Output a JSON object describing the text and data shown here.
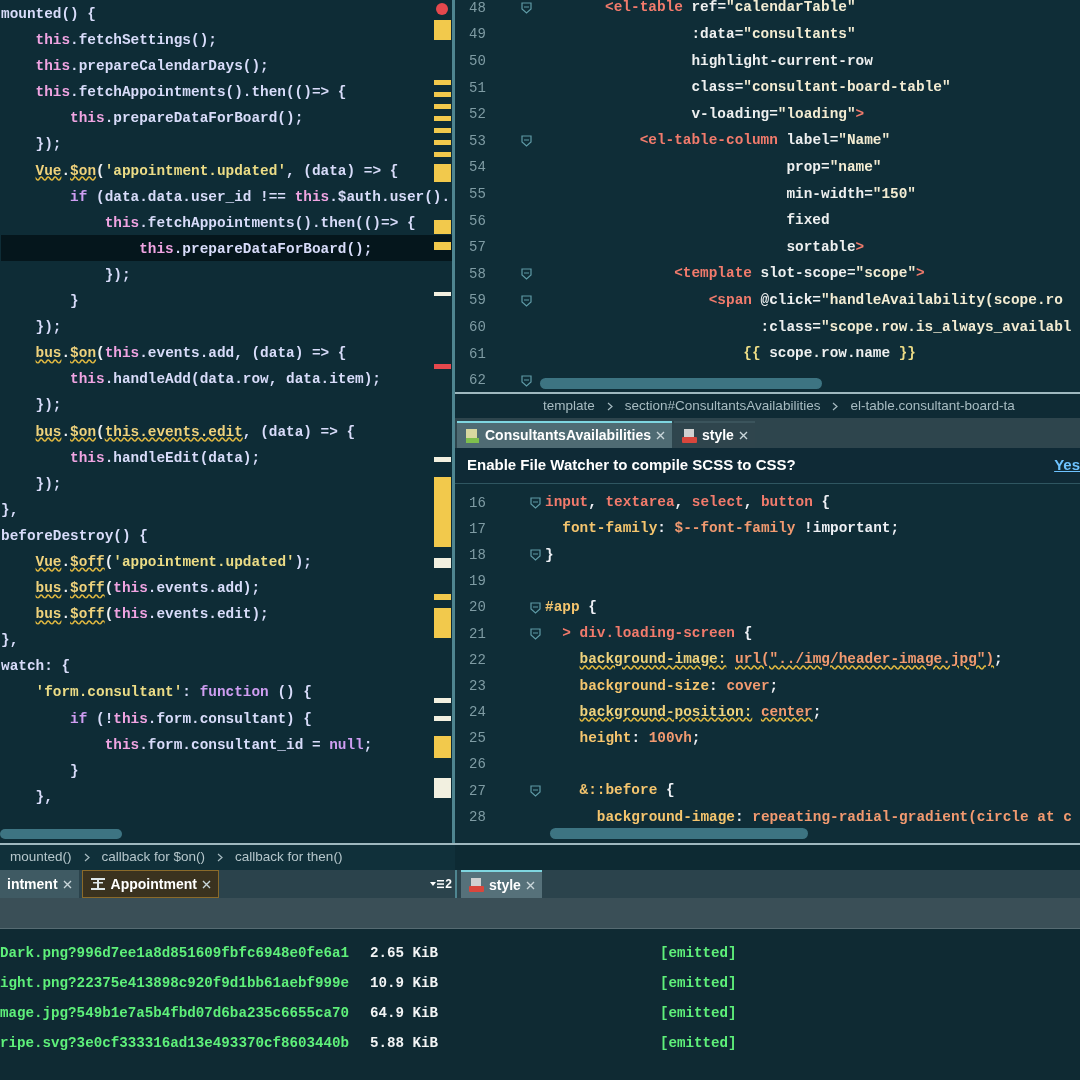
{
  "left_editor": {
    "lines": [
      {
        "current": false,
        "tokens": [
          {
            "text": "mounted() {",
            "kind": "ident"
          }
        ]
      },
      {
        "current": false,
        "tokens": [
          {
            "text": "    this",
            "kind": "this"
          },
          {
            "text": ".fetchSettings();",
            "kind": "ident"
          }
        ]
      },
      {
        "current": false,
        "tokens": [
          {
            "text": "    this",
            "kind": "this"
          },
          {
            "text": ".prepareCalendarDays();",
            "kind": "ident"
          }
        ]
      },
      {
        "current": false,
        "tokens": [
          {
            "text": "    this",
            "kind": "this"
          },
          {
            "text": ".fetchAppointments().then(()=> {",
            "kind": "ident"
          }
        ]
      },
      {
        "current": false,
        "tokens": [
          {
            "text": "        this",
            "kind": "this"
          },
          {
            "text": ".prepareDataForBoard();",
            "kind": "ident"
          }
        ]
      },
      {
        "current": false,
        "tokens": [
          {
            "text": "    });",
            "kind": "ident"
          }
        ]
      },
      {
        "current": false,
        "tokens": [
          {
            "text": "    Vue",
            "kind": "warn"
          },
          {
            "text": ".",
            "kind": "punct"
          },
          {
            "text": "$on",
            "kind": "warn"
          },
          {
            "text": "(",
            "kind": "punct"
          },
          {
            "text": "'appointment.updated'",
            "kind": "str"
          },
          {
            "text": ", (data) => {",
            "kind": "ident"
          }
        ]
      },
      {
        "current": false,
        "tokens": [
          {
            "text": "        if",
            "kind": "kw"
          },
          {
            "text": " (data.data.user_id !== ",
            "kind": "ident"
          },
          {
            "text": "this",
            "kind": "this"
          },
          {
            "text": ".$auth.user().",
            "kind": "ident"
          }
        ]
      },
      {
        "current": false,
        "tokens": [
          {
            "text": "            this",
            "kind": "this"
          },
          {
            "text": ".fetchAppointments().then(()=> {",
            "kind": "ident"
          }
        ]
      },
      {
        "current": true,
        "tokens": [
          {
            "text": "                this",
            "kind": "this"
          },
          {
            "text": ".prepareDataForBoard();",
            "kind": "ident"
          }
        ]
      },
      {
        "current": false,
        "tokens": [
          {
            "text": "            });",
            "kind": "ident"
          }
        ]
      },
      {
        "current": false,
        "tokens": [
          {
            "text": "        }",
            "kind": "ident"
          }
        ]
      },
      {
        "current": false,
        "tokens": [
          {
            "text": "    });",
            "kind": "ident"
          }
        ]
      },
      {
        "current": false,
        "tokens": [
          {
            "text": "    bus",
            "kind": "warn"
          },
          {
            "text": ".",
            "kind": "punct"
          },
          {
            "text": "$on",
            "kind": "warn"
          },
          {
            "text": "(",
            "kind": "punct"
          },
          {
            "text": "this",
            "kind": "this"
          },
          {
            "text": ".events.add, (data) => {",
            "kind": "ident"
          }
        ]
      },
      {
        "current": false,
        "tokens": [
          {
            "text": "        this",
            "kind": "this"
          },
          {
            "text": ".handleAdd(data.row, data.item);",
            "kind": "ident"
          }
        ]
      },
      {
        "current": false,
        "tokens": [
          {
            "text": "    });",
            "kind": "ident"
          }
        ]
      },
      {
        "current": false,
        "tokens": [
          {
            "text": "    bus",
            "kind": "warn"
          },
          {
            "text": ".",
            "kind": "punct"
          },
          {
            "text": "$on",
            "kind": "warn"
          },
          {
            "text": "(",
            "kind": "punct"
          },
          {
            "text": "this.events.edit",
            "kind": "warn"
          },
          {
            "text": ", (data) => {",
            "kind": "ident"
          }
        ]
      },
      {
        "current": false,
        "tokens": [
          {
            "text": "        this",
            "kind": "this"
          },
          {
            "text": ".handleEdit(data);",
            "kind": "ident"
          }
        ]
      },
      {
        "current": false,
        "tokens": [
          {
            "text": "    });",
            "kind": "ident"
          }
        ]
      },
      {
        "current": false,
        "tokens": [
          {
            "text": "},",
            "kind": "ident"
          }
        ]
      },
      {
        "current": false,
        "tokens": [
          {
            "text": "beforeDestroy() {",
            "kind": "ident"
          }
        ]
      },
      {
        "current": false,
        "tokens": [
          {
            "text": "    Vue",
            "kind": "warn"
          },
          {
            "text": ".",
            "kind": "punct"
          },
          {
            "text": "$off",
            "kind": "warn"
          },
          {
            "text": "(",
            "kind": "punct"
          },
          {
            "text": "'appointment.updated'",
            "kind": "str"
          },
          {
            "text": ");",
            "kind": "ident"
          }
        ]
      },
      {
        "current": false,
        "tokens": [
          {
            "text": "    bus",
            "kind": "warn"
          },
          {
            "text": ".",
            "kind": "punct"
          },
          {
            "text": "$off",
            "kind": "warn"
          },
          {
            "text": "(",
            "kind": "punct"
          },
          {
            "text": "this",
            "kind": "this"
          },
          {
            "text": ".events.add);",
            "kind": "ident"
          }
        ]
      },
      {
        "current": false,
        "tokens": [
          {
            "text": "    bus",
            "kind": "warn"
          },
          {
            "text": ".",
            "kind": "punct"
          },
          {
            "text": "$off",
            "kind": "warn"
          },
          {
            "text": "(",
            "kind": "punct"
          },
          {
            "text": "this",
            "kind": "this"
          },
          {
            "text": ".events.edit);",
            "kind": "ident"
          }
        ]
      },
      {
        "current": false,
        "tokens": [
          {
            "text": "},",
            "kind": "ident"
          }
        ]
      },
      {
        "current": false,
        "tokens": [
          {
            "text": "watch: {",
            "kind": "ident"
          }
        ]
      },
      {
        "current": false,
        "tokens": [
          {
            "text": "    'form.consultant'",
            "kind": "str"
          },
          {
            "text": ": ",
            "kind": "ident"
          },
          {
            "text": "function",
            "kind": "kw"
          },
          {
            "text": " () {",
            "kind": "ident"
          }
        ]
      },
      {
        "current": false,
        "tokens": [
          {
            "text": "        if",
            "kind": "kw"
          },
          {
            "text": " (!",
            "kind": "ident"
          },
          {
            "text": "this",
            "kind": "this"
          },
          {
            "text": ".form.consultant) {",
            "kind": "ident"
          }
        ]
      },
      {
        "current": false,
        "tokens": [
          {
            "text": "            this",
            "kind": "this"
          },
          {
            "text": ".form.consultant_id = ",
            "kind": "ident"
          },
          {
            "text": "null",
            "kind": "kw"
          },
          {
            "text": ";",
            "kind": "ident"
          }
        ]
      },
      {
        "current": false,
        "tokens": [
          {
            "text": "        }",
            "kind": "ident"
          }
        ]
      },
      {
        "current": false,
        "tokens": [
          {
            "text": "    },",
            "kind": "ident"
          }
        ]
      }
    ],
    "breadcrumb": [
      "mounted()",
      "callback for $on()",
      "callback for then()"
    ]
  },
  "top_right_editor": {
    "lines": [
      {
        "number": "48",
        "fold": true,
        "tokens": [
          {
            "text": "        <el-table",
            "kind": "tag"
          },
          {
            "text": " ref=",
            "kind": "attr"
          },
          {
            "text": "\"calendarTable\"",
            "kind": "quoted"
          }
        ]
      },
      {
        "number": "49",
        "fold": false,
        "tokens": [
          {
            "text": "                  :data=",
            "kind": "attr"
          },
          {
            "text": "\"consultants\"",
            "kind": "quoted"
          }
        ]
      },
      {
        "number": "50",
        "fold": false,
        "tokens": [
          {
            "text": "                  highlight-current-row",
            "kind": "attr"
          }
        ]
      },
      {
        "number": "51",
        "fold": false,
        "tokens": [
          {
            "text": "                  class=",
            "kind": "attr"
          },
          {
            "text": "\"consultant-board-table\"",
            "kind": "quoted"
          }
        ]
      },
      {
        "number": "52",
        "fold": false,
        "tokens": [
          {
            "text": "                  v-loading=",
            "kind": "attr"
          },
          {
            "text": "\"loading\"",
            "kind": "quoted"
          },
          {
            "text": ">",
            "kind": "tag"
          }
        ]
      },
      {
        "number": "53",
        "fold": true,
        "tokens": [
          {
            "text": "            <el-table-column",
            "kind": "tag"
          },
          {
            "text": " label=",
            "kind": "attr"
          },
          {
            "text": "\"Name\"",
            "kind": "quoted"
          }
        ]
      },
      {
        "number": "54",
        "fold": false,
        "tokens": [
          {
            "text": "                             prop=",
            "kind": "attr"
          },
          {
            "text": "\"name\"",
            "kind": "quoted"
          }
        ]
      },
      {
        "number": "55",
        "fold": false,
        "tokens": [
          {
            "text": "                             min-width=",
            "kind": "attr"
          },
          {
            "text": "\"150\"",
            "kind": "quoted"
          }
        ]
      },
      {
        "number": "56",
        "fold": false,
        "tokens": [
          {
            "text": "                             fixed",
            "kind": "attr"
          }
        ]
      },
      {
        "number": "57",
        "fold": false,
        "tokens": [
          {
            "text": "                             sortable",
            "kind": "attr"
          },
          {
            "text": ">",
            "kind": "tag"
          }
        ]
      },
      {
        "number": "58",
        "fold": true,
        "tokens": [
          {
            "text": "                <template",
            "kind": "tag"
          },
          {
            "text": " slot-scope=",
            "kind": "attr"
          },
          {
            "text": "\"scope\"",
            "kind": "quoted"
          },
          {
            "text": ">",
            "kind": "tag"
          }
        ]
      },
      {
        "number": "59",
        "fold": true,
        "tokens": [
          {
            "text": "                    <span",
            "kind": "tag"
          },
          {
            "text": " @click=",
            "kind": "attr"
          },
          {
            "text": "\"handleAvailability(scope.ro",
            "kind": "quoted"
          }
        ]
      },
      {
        "number": "60",
        "fold": false,
        "tokens": [
          {
            "text": "                          :class=",
            "kind": "attr"
          },
          {
            "text": "\"scope.row.is_always_availabl",
            "kind": "quoted"
          }
        ]
      },
      {
        "number": "61",
        "fold": false,
        "tokens": [
          {
            "text": "                        {{",
            "kind": "str"
          },
          {
            "text": " scope.row.name ",
            "kind": "attr"
          },
          {
            "text": "}}",
            "kind": "str"
          }
        ]
      },
      {
        "number": "62",
        "fold": true
      }
    ],
    "breadcrumb": [
      "template",
      "section#ConsultantsAvailabilities",
      "el-table.consultant-board-ta"
    ]
  },
  "top_right_tabs": [
    {
      "label": "ConsultantsAvailabilities",
      "selected": true,
      "kind": "html"
    },
    {
      "label": "style",
      "selected": false,
      "kind": "sass"
    }
  ],
  "notification": {
    "message": "Enable File Watcher to compile SCSS to CSS?",
    "action": "Yes"
  },
  "bottom_right_editor": {
    "lines": [
      {
        "number": "16",
        "fold": true,
        "tokens": [
          {
            "text": "input",
            "kind": "sel"
          },
          {
            "text": ", ",
            "kind": "punct"
          },
          {
            "text": "textarea",
            "kind": "sel"
          },
          {
            "text": ", ",
            "kind": "punct"
          },
          {
            "text": "select",
            "kind": "sel"
          },
          {
            "text": ", ",
            "kind": "punct"
          },
          {
            "text": "button",
            "kind": "sel"
          },
          {
            "text": " {",
            "kind": "punct"
          }
        ]
      },
      {
        "number": "17",
        "fold": false,
        "tokens": [
          {
            "text": "  font-family",
            "kind": "prop"
          },
          {
            "text": ": ",
            "kind": "punct"
          },
          {
            "text": "$--font-family",
            "kind": "val"
          },
          {
            "text": " !important;",
            "kind": "punct"
          }
        ]
      },
      {
        "number": "18",
        "fold": true,
        "tokens": [
          {
            "text": "}",
            "kind": "punct"
          }
        ]
      },
      {
        "number": "19",
        "fold": false
      },
      {
        "number": "20",
        "fold": true,
        "tokens": [
          {
            "text": "#app",
            "kind": "prop"
          },
          {
            "text": " {",
            "kind": "punct"
          }
        ]
      },
      {
        "number": "21",
        "fold": true,
        "tokens": [
          {
            "text": "  > div.loading-screen",
            "kind": "sel"
          },
          {
            "text": " {",
            "kind": "punct"
          }
        ]
      },
      {
        "number": "22",
        "fold": false,
        "tokens": [
          {
            "text": "    background-image:",
            "kind": "warn"
          },
          {
            "text": " url(\"../img/header-image.jpg\")",
            "kind": "warnval"
          },
          {
            "text": ";",
            "kind": "punct"
          }
        ]
      },
      {
        "number": "23",
        "fold": false,
        "tokens": [
          {
            "text": "    background-size",
            "kind": "prop"
          },
          {
            "text": ": ",
            "kind": "punct"
          },
          {
            "text": "cover",
            "kind": "val"
          },
          {
            "text": ";",
            "kind": "punct"
          }
        ]
      },
      {
        "number": "24",
        "fold": false,
        "tokens": [
          {
            "text": "    background-position:",
            "kind": "warn"
          },
          {
            "text": " center",
            "kind": "warnval"
          },
          {
            "text": ";",
            "kind": "punct"
          }
        ]
      },
      {
        "number": "25",
        "fold": false,
        "tokens": [
          {
            "text": "    height",
            "kind": "prop"
          },
          {
            "text": ": ",
            "kind": "punct"
          },
          {
            "text": "100vh",
            "kind": "val"
          },
          {
            "text": ";",
            "kind": "punct"
          }
        ]
      },
      {
        "number": "26",
        "fold": false
      },
      {
        "number": "27",
        "fold": true,
        "tokens": [
          {
            "text": "    &::before",
            "kind": "prop"
          },
          {
            "text": " {",
            "kind": "punct"
          }
        ]
      },
      {
        "number": "28",
        "fold": false,
        "tokens": [
          {
            "text": "      background-image",
            "kind": "prop"
          },
          {
            "text": ": ",
            "kind": "punct"
          },
          {
            "text": "repeating-radial-gradient(circle at c",
            "kind": "val"
          }
        ]
      }
    ]
  },
  "bottom_left_tabs": [
    {
      "label": "intment",
      "selected": false,
      "kind": "plain"
    },
    {
      "label": "Appointment",
      "selected": true,
      "kind": "component"
    }
  ],
  "tab_list_count": "2",
  "bottom_right_tabs": [
    {
      "label": "style",
      "selected": true,
      "kind": "sass"
    }
  ],
  "build_output": [
    {
      "file": "Dark.png?996d7ee1a8d851609fbfc6948e0fe6a1",
      "size": "2.65 KiB",
      "status": "[emitted]"
    },
    {
      "file": "ight.png?22375e413898c920f9d1bb61aebf999e",
      "size": "10.9 KiB",
      "status": "[emitted]"
    },
    {
      "file": "mage.jpg?549b1e7a5b4fbd07d6ba235c6655ca70",
      "size": "64.9 KiB",
      "status": "[emitted]"
    },
    {
      "file": "ripe.svg?3e0cf333316ad13e493370cf8603440b",
      "size": "5.88 KiB",
      "status": "[emitted]"
    }
  ]
}
